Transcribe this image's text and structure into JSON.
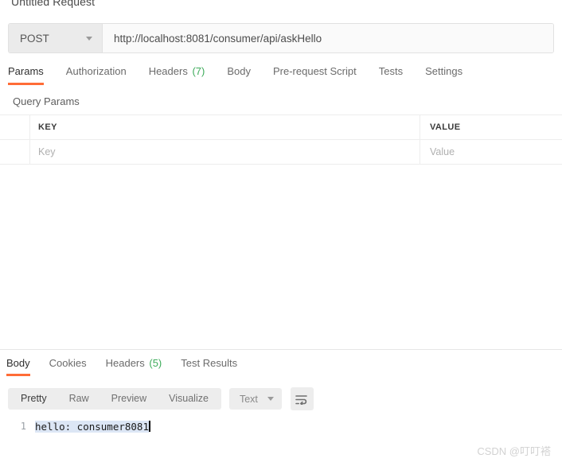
{
  "request": {
    "title": "Untitled Request",
    "method": "POST",
    "url": "http://localhost:8081/consumer/api/askHello",
    "tabs": [
      {
        "label": "Params",
        "count": "",
        "active": true
      },
      {
        "label": "Authorization",
        "count": "",
        "active": false
      },
      {
        "label": "Headers",
        "count": "(7)",
        "active": false
      },
      {
        "label": "Body",
        "count": "",
        "active": false
      },
      {
        "label": "Pre-request Script",
        "count": "",
        "active": false
      },
      {
        "label": "Tests",
        "count": "",
        "active": false
      },
      {
        "label": "Settings",
        "count": "",
        "active": false
      }
    ],
    "query_params": {
      "section_title": "Query Params",
      "headers": {
        "key": "KEY",
        "value": "VALUE"
      },
      "rows": [
        {
          "key_placeholder": "Key",
          "value_placeholder": "Value"
        }
      ]
    }
  },
  "response": {
    "tabs": [
      {
        "label": "Body",
        "count": "",
        "active": true
      },
      {
        "label": "Cookies",
        "count": "",
        "active": false
      },
      {
        "label": "Headers",
        "count": "(5)",
        "active": false
      },
      {
        "label": "Test Results",
        "count": "",
        "active": false
      }
    ],
    "view_modes": [
      {
        "label": "Pretty",
        "active": true
      },
      {
        "label": "Raw",
        "active": false
      },
      {
        "label": "Preview",
        "active": false
      },
      {
        "label": "Visualize",
        "active": false
      }
    ],
    "format": "Text",
    "wrap_icon": "wrap-lines-icon",
    "body": {
      "line_number": "1",
      "text": "hello: consumer8081"
    }
  },
  "watermark": "CSDN @叮叮褡",
  "colors": {
    "accent": "#ff6c37",
    "count_green": "#3dab5a",
    "selection": "#dce6f5"
  }
}
